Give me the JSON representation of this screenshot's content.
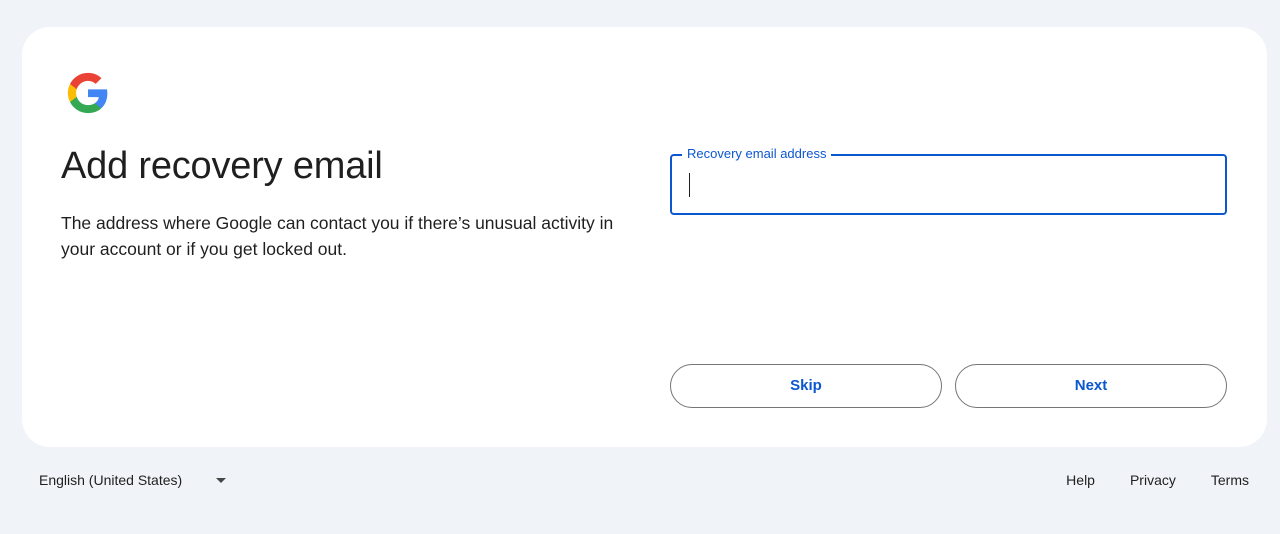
{
  "logo": {
    "icon": "google-g-icon",
    "colors": [
      "#4285f4",
      "#34a853",
      "#fbbc05",
      "#ea4335"
    ]
  },
  "title": "Add recovery email",
  "description": "The address where Google can contact you if there’s unusual activity in your account or if you get locked out.",
  "field": {
    "label": "Recovery email address",
    "value": "",
    "accent": "#0b57d0"
  },
  "buttons": {
    "skip": "Skip",
    "next": "Next"
  },
  "footer": {
    "language": "English (United States)",
    "links": [
      "Help",
      "Privacy",
      "Terms"
    ]
  },
  "colors": {
    "background": "#f0f4f9",
    "card": "#ffffff",
    "accent": "#0b57d0"
  }
}
